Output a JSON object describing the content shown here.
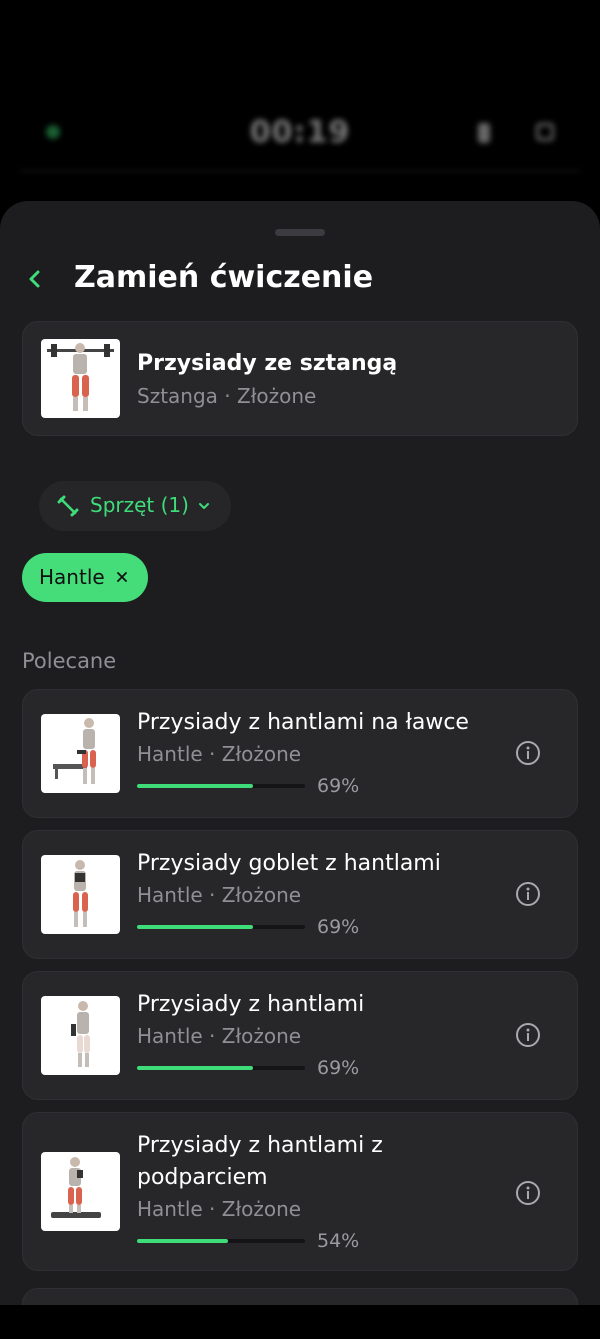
{
  "topbar": {
    "timer": "00:19"
  },
  "sheet": {
    "title": "Zamień ćwiczenie",
    "current": {
      "name": "Przysiady ze sztangą",
      "meta": "Sztanga · Złożone"
    },
    "filter": {
      "label": "Sprzęt (1)"
    },
    "chip": {
      "label": "Hantle"
    },
    "section_label": "Polecane",
    "suggestions": [
      {
        "name": "Przysiady z hantlami na ławce",
        "meta": "Hantle · Złożone",
        "percent": 69,
        "percent_label": "69%"
      },
      {
        "name": "Przysiady goblet z hantlami",
        "meta": "Hantle · Złożone",
        "percent": 69,
        "percent_label": "69%"
      },
      {
        "name": "Przysiady z hantlami",
        "meta": "Hantle · Złożone",
        "percent": 69,
        "percent_label": "69%"
      },
      {
        "name_line1": "Przysiady z hantlami z",
        "name_line2": "podparciem",
        "meta": "Hantle · Złożone",
        "percent": 54,
        "percent_label": "54%"
      }
    ]
  },
  "colors": {
    "accent": "#3fdc7a",
    "chip": "#44dd7a",
    "sheet": "#1d1d20",
    "card": "#27272a"
  },
  "icons": [
    "chevron-left-icon",
    "dumbbell-icon",
    "chevron-down-icon",
    "close-icon",
    "info-icon"
  ]
}
